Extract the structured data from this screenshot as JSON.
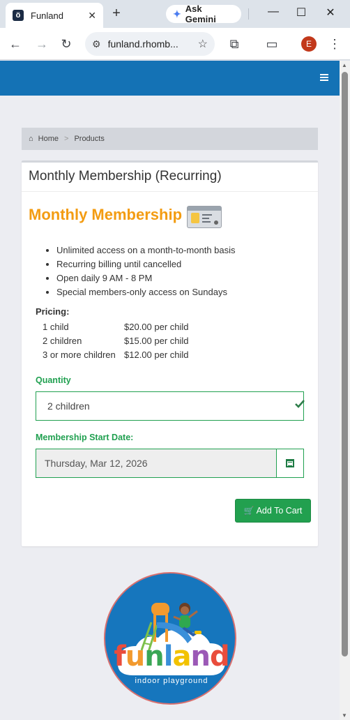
{
  "browser": {
    "tab_title": "Funland",
    "favicon_letter": "ö",
    "gemini_label": "Ask Gemini",
    "url": "funland.rhomb...",
    "profile_initial": "E"
  },
  "breadcrumb": {
    "home": "Home",
    "separator": ">",
    "current": "Products"
  },
  "product": {
    "card_title": "Monthly Membership (Recurring)",
    "heading": "Monthly Membership",
    "features": [
      "Unlimited access on a month-to-month basis",
      "Recurring billing until cancelled",
      "Open daily 9 AM - 8 PM",
      "Special members-only access on Sundays"
    ],
    "pricing_label": "Pricing:",
    "pricing": [
      {
        "qty": "1 child",
        "price": "$20.00 per child"
      },
      {
        "qty": "2 children",
        "price": "$15.00 per child"
      },
      {
        "qty": "3 or more children",
        "price": "$12.00 per child"
      }
    ]
  },
  "form": {
    "quantity_label": "Quantity",
    "quantity_value": "2 children",
    "start_date_label": "Membership Start Date:",
    "start_date_value": "Thursday, Mar 12, 2026",
    "add_to_cart": "Add To Cart"
  },
  "logo": {
    "wordmark": "funland",
    "tagline": "indoor playground"
  },
  "colors": {
    "header_blue": "#1472b5",
    "accent_orange": "#f39c12",
    "success_green": "#20a050"
  }
}
